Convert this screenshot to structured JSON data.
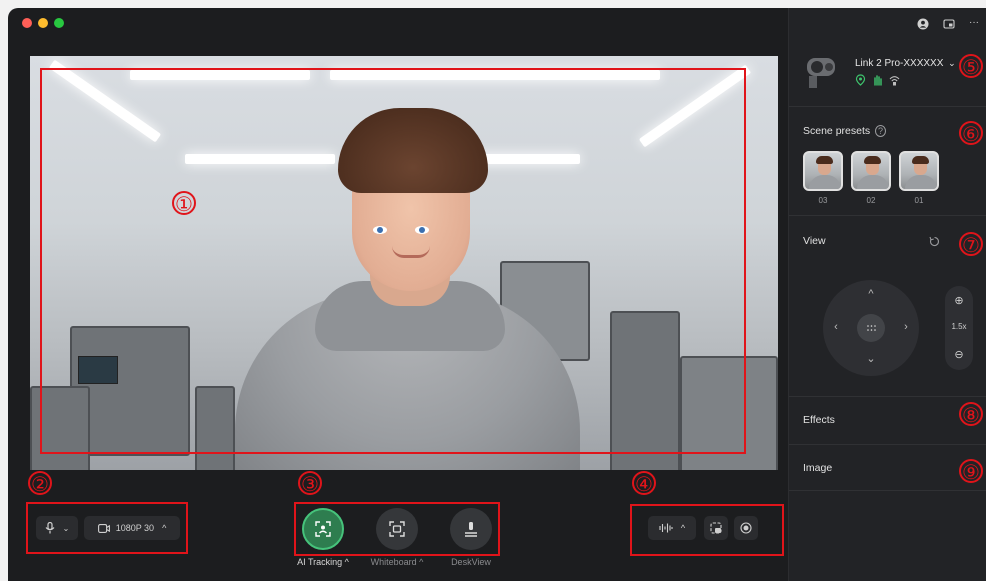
{
  "window": {
    "traffic_lights": [
      "close",
      "minimize",
      "zoom"
    ]
  },
  "annotations": {
    "markers": [
      "①",
      "②",
      "③",
      "④",
      "⑤",
      "⑥",
      "⑦",
      "⑧",
      "⑨"
    ]
  },
  "bottom_bar": {
    "resolution_label": "1080P 30",
    "modes": [
      {
        "label": "AI Tracking ^",
        "icon": "ai-tracking-icon",
        "active": true
      },
      {
        "label": "Whiteboard ^",
        "icon": "whiteboard-icon",
        "active": false
      },
      {
        "label": "DeskView",
        "icon": "deskview-icon",
        "active": false
      }
    ]
  },
  "sidebar": {
    "device": {
      "name": "Link 2 Pro-XXXXXX",
      "status_icons": [
        "location-icon",
        "gesture-icon",
        "wireless-icon"
      ],
      "status_color": "#3ec46d"
    },
    "scene_presets": {
      "title": "Scene presets",
      "items": [
        "03",
        "02",
        "01"
      ]
    },
    "view": {
      "title": "View",
      "zoom_level": "1.5x"
    },
    "effects": {
      "title": "Effects"
    },
    "image": {
      "title": "Image"
    }
  },
  "colors": {
    "accent_green": "#2e7d4f",
    "annotation_red": "#e0141a"
  }
}
